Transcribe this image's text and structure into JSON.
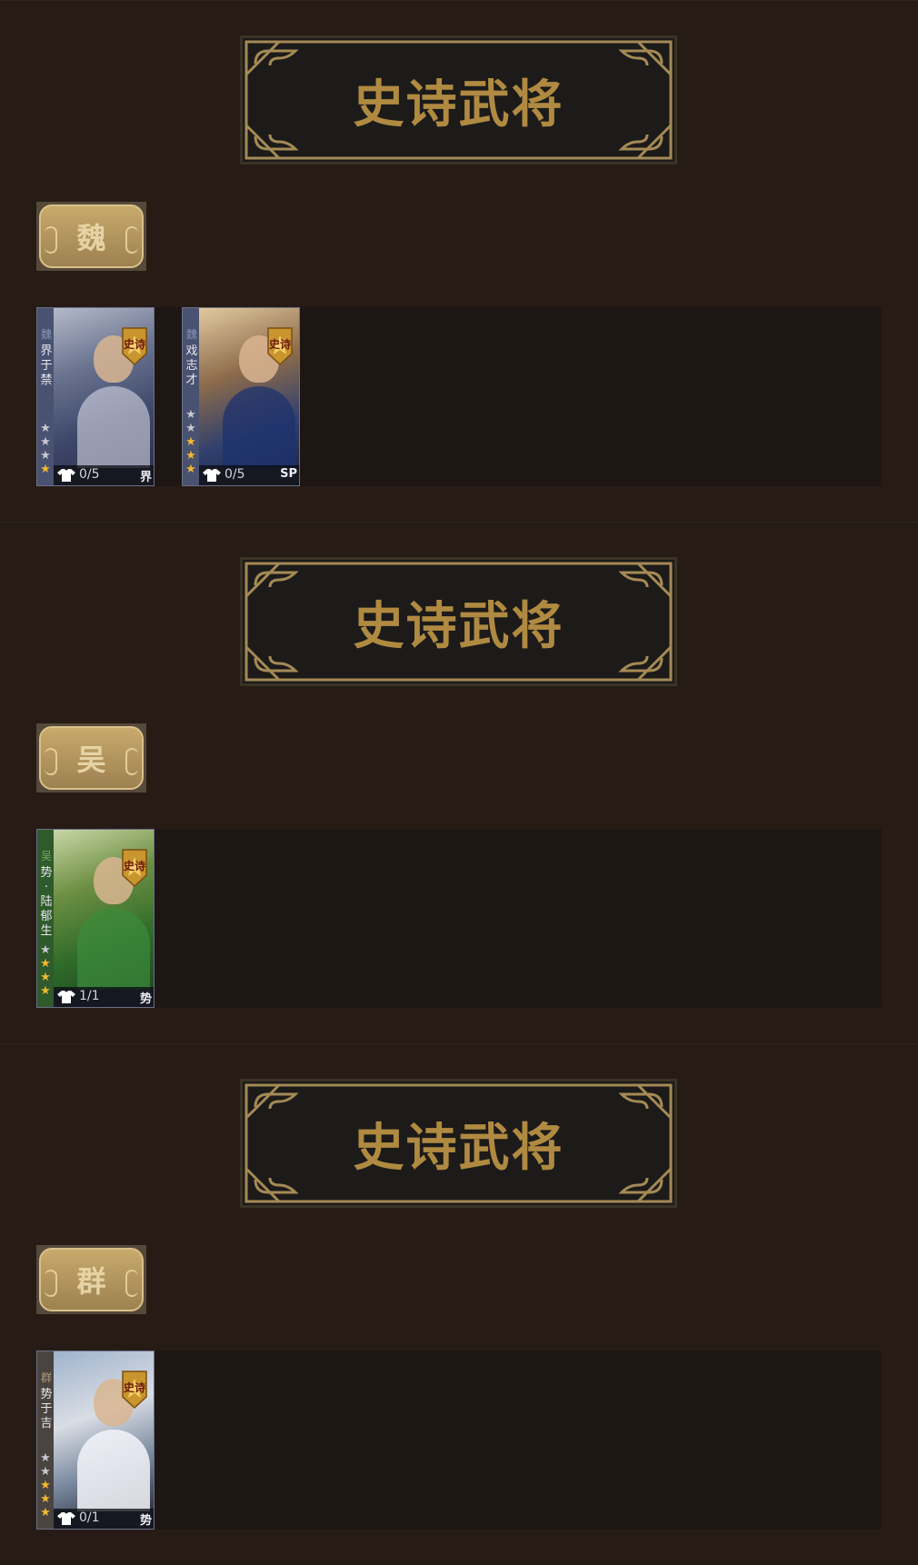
{
  "sections": [
    {
      "banner_title": "史诗武将",
      "faction": "魏",
      "cards": [
        {
          "faction": "魏",
          "name": "界于禁",
          "stars_on": 1,
          "stars_total": 4,
          "skins": "0/5",
          "type": "界"
        },
        {
          "faction": "魏",
          "name": "戏志才",
          "stars_on": 3,
          "stars_total": 5,
          "skins": "0/5",
          "type": "SP"
        }
      ]
    },
    {
      "banner_title": "史诗武将",
      "faction": "吴",
      "cards": [
        {
          "faction": "吴",
          "name": "势·陆郁生",
          "stars_on": 3,
          "stars_total": 4,
          "skins": "1/1",
          "type": "势"
        }
      ]
    },
    {
      "banner_title": "史诗武将",
      "faction": "群",
      "cards": [
        {
          "faction": "群",
          "name": "势于吉",
          "stars_on": 3,
          "stars_total": 5,
          "skins": "0/1",
          "type": "势"
        }
      ]
    }
  ],
  "badge_text": "史诗",
  "colors": {
    "background": "#261c15",
    "gold_text": "#b08a41",
    "banner_bg": "#1c1b1a",
    "star_on": "#f2b830"
  },
  "icons": [
    "banner-frame-icon",
    "epic-badge-icon",
    "skin-icon",
    "star-icon"
  ]
}
